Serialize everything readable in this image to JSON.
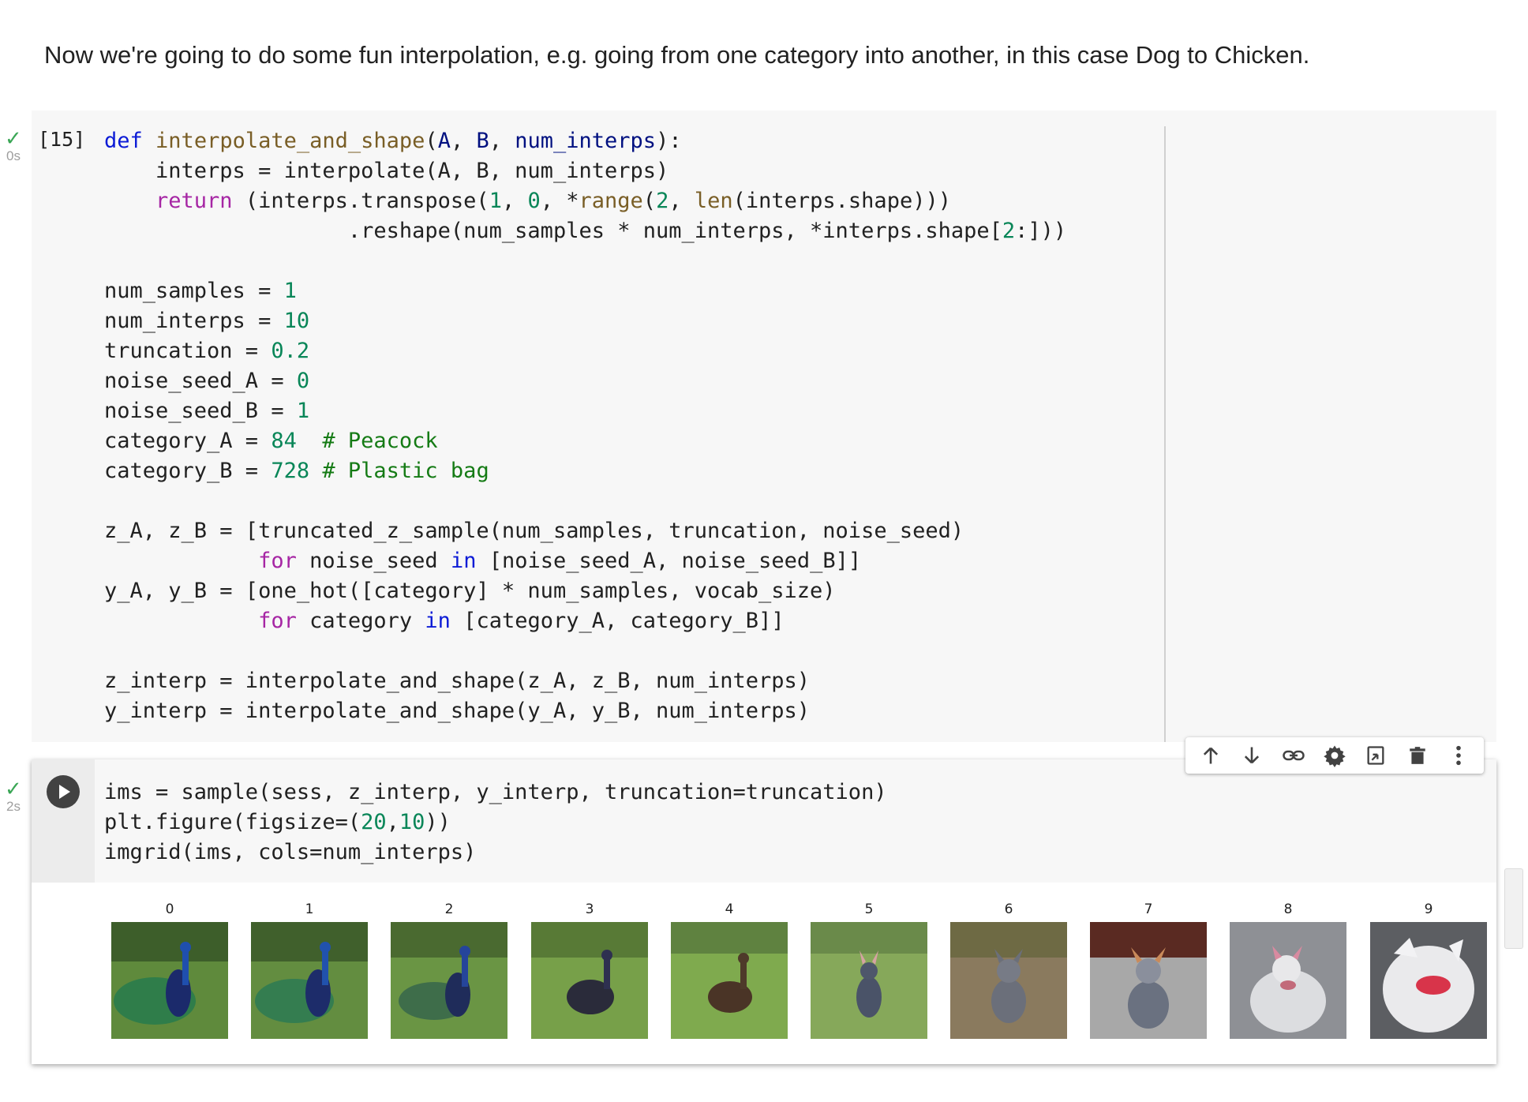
{
  "markdown": {
    "text": "Now we're going to do some fun interpolation, e.g. going from one category into another, in this case Dog to Chicken."
  },
  "cell1": {
    "exec_count": "[15]",
    "status_time": "0s"
  },
  "cell2": {
    "status_time": "2s"
  },
  "toolbar": {
    "icons": [
      "arrow-up-icon",
      "arrow-down-icon",
      "link-icon",
      "gear-icon",
      "mirror-cell-icon",
      "trash-icon",
      "more-vert-icon"
    ]
  },
  "output": {
    "labels": [
      "0",
      "1",
      "2",
      "3",
      "4",
      "5",
      "6",
      "7",
      "8",
      "9"
    ]
  },
  "colors": {
    "keyword": "#0c1bd6",
    "keyword_flow": "#a626a4",
    "function": "#795e26",
    "number": "#098658",
    "comment": "#157b15",
    "check": "#3aa655"
  }
}
